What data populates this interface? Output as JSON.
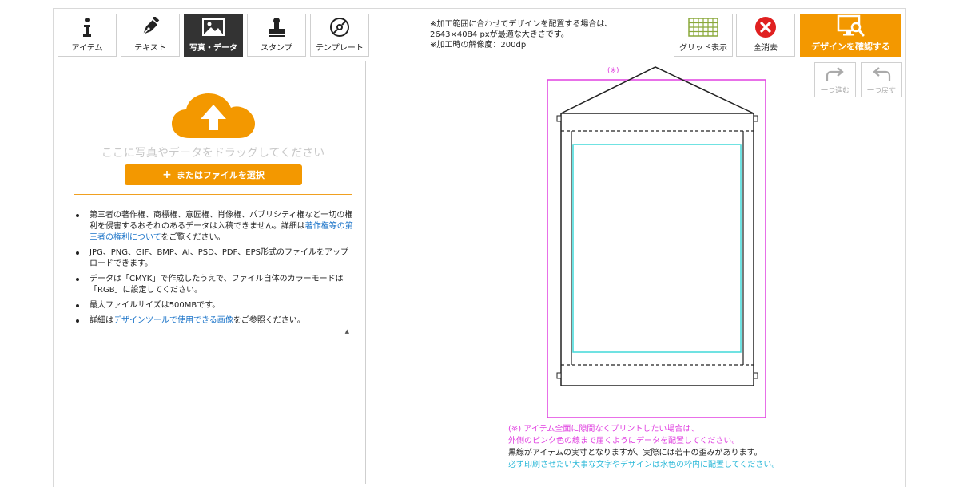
{
  "tabs": [
    {
      "label": "アイテム",
      "icon": "info-icon"
    },
    {
      "label": "テキスト",
      "icon": "pen-icon"
    },
    {
      "label": "写真・データ",
      "icon": "image-icon",
      "active": true
    },
    {
      "label": "スタンプ",
      "icon": "stamp-icon"
    },
    {
      "label": "テンプレート",
      "icon": "template-icon"
    }
  ],
  "upload": {
    "drop_text": "ここに写真やデータをドラッグしてください",
    "select_button": "またはファイルを選択"
  },
  "notes": {
    "n1_a": "第三者の著作権、商標権、意匠権、肖像権、パブリシティ権など一切の権利を侵害するおそれのあるデータは入稿できません。詳細は",
    "n1_link": "著作権等の第三者の権利について",
    "n1_b": "をご覧ください。",
    "n2": "JPG、PNG、GIF、BMP、AI、PSD、PDF、EPS形式のファイルをアップロードできます。",
    "n3": "データは「CMYK」で作成したうえで、ファイル自体のカラーモードは「RGB」に設定してください。",
    "n4": "最大ファイルサイズは500MBです。",
    "n5_a": "詳細は",
    "n5_link": "デザインツールで使用できる画像",
    "n5_b": "をご参照ください。"
  },
  "info": {
    "line1": "※加工範囲に合わせてデザインを配置する場合は、",
    "line2": "2643×4084 pxが最適な大きさです。",
    "line3": "※加工時の解像度：200dpi"
  },
  "toolbar": {
    "grid_label": "グリッド表示",
    "clear_label": "全消去",
    "confirm_label": "デザインを確認する",
    "redo_label": "一つ進む",
    "undo_label": "一つ戻す"
  },
  "canvas": {
    "mark": "(※)"
  },
  "legend": {
    "pink1": "(※) アイテム全面に隙間なくプリントしたい場合は、",
    "pink2": "外側のピンク色の線まで届くようにデータを配置してください。",
    "black": "黒線がアイテムの実寸となりますが、実際には若干の歪みがあります。",
    "cyan": "必ず印刷させたい大事な文字やデザインは水色の枠内に配置してください。"
  },
  "colors": {
    "accent": "#f39800",
    "active_tab": "#333333",
    "bleed_line": "#e040e0",
    "safe_line": "#40d8d8",
    "clear_red": "#e02020",
    "grid_green": "#8aa83a",
    "link": "#1a73c8"
  }
}
